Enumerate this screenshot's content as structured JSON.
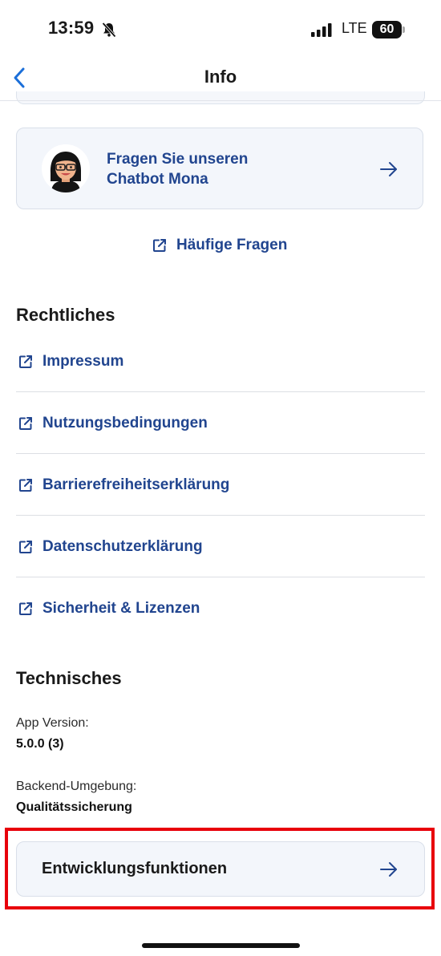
{
  "status_bar": {
    "time": "13:59",
    "network": "LTE",
    "battery": "60"
  },
  "nav": {
    "title": "Info",
    "back_icon": "chevron-left-icon"
  },
  "chatbot_card": {
    "line1": "Fragen Sie unseren",
    "line2": "Chatbot Mona",
    "arrow_icon": "arrow-right-icon"
  },
  "faq_link": {
    "label": "Häufige Fragen",
    "icon": "external-link-icon"
  },
  "legal": {
    "title": "Rechtliches",
    "items": [
      {
        "label": "Impressum"
      },
      {
        "label": "Nutzungsbedingungen"
      },
      {
        "label": "Barrierefreiheitserklärung"
      },
      {
        "label": "Datenschutzerklärung"
      },
      {
        "label": "Sicherheit & Lizenzen"
      }
    ]
  },
  "technical": {
    "title": "Technisches",
    "app_version_label": "App Version:",
    "app_version_value": "5.0.0 (3)",
    "backend_label": "Backend-Umgebung:",
    "backend_value": "Qualitätssicherung"
  },
  "dev_card": {
    "label": "Entwicklungsfunktionen",
    "arrow_icon": "arrow-right-icon"
  },
  "colors": {
    "link": "#21458f",
    "accent_blue": "#1b6fd9",
    "highlight": "#e8000b",
    "card_bg": "#f3f6fb"
  }
}
